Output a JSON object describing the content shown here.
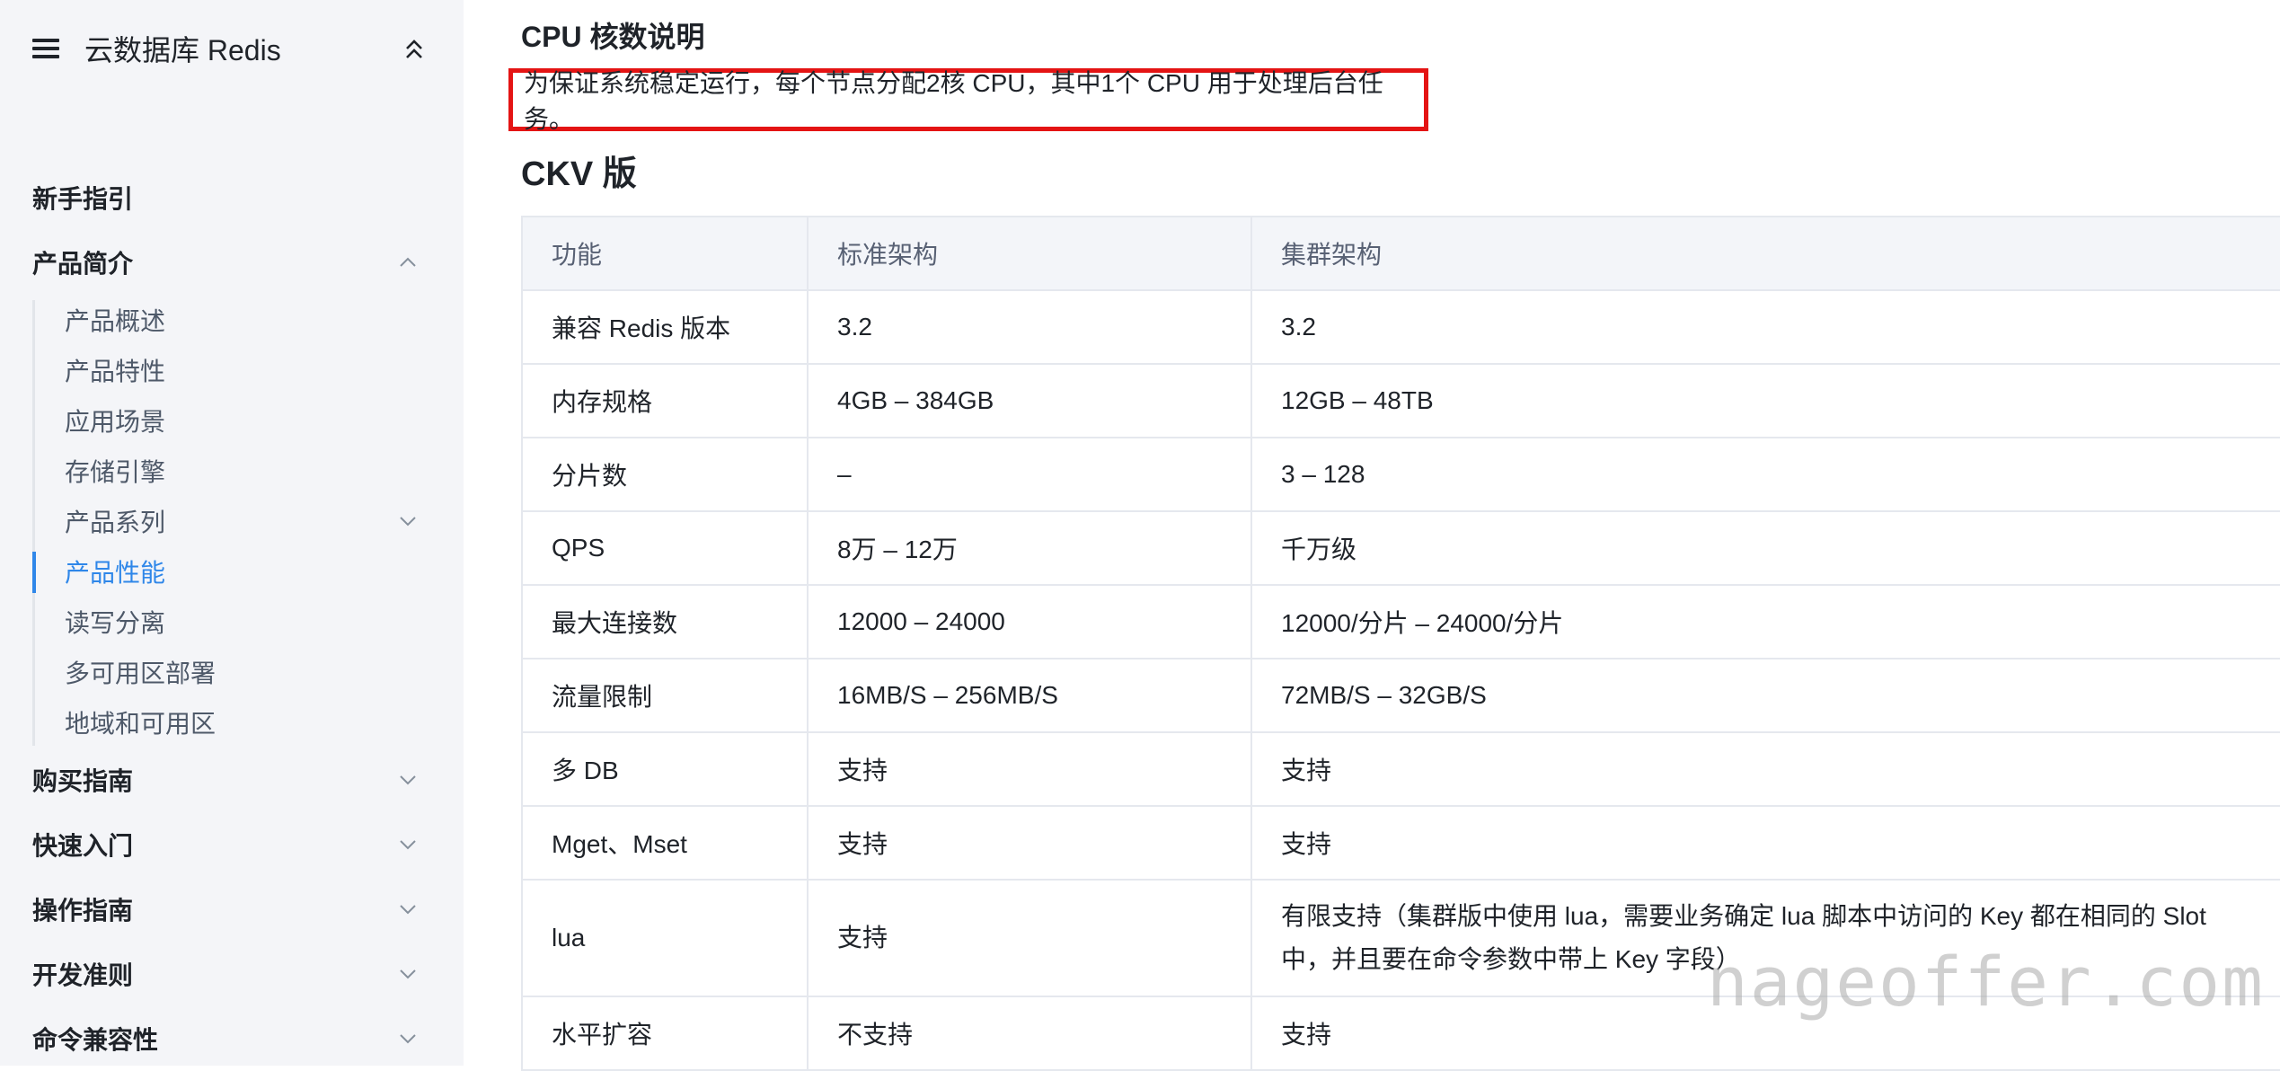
{
  "sidebar": {
    "title": "云数据库 Redis",
    "groups": [
      {
        "label": "新手指引"
      },
      {
        "label": "产品简介"
      },
      {
        "label": "购买指南"
      },
      {
        "label": "快速入门"
      },
      {
        "label": "操作指南"
      },
      {
        "label": "开发准则"
      },
      {
        "label": "命令兼容性"
      }
    ],
    "sub_items": [
      {
        "label": "产品概述"
      },
      {
        "label": "产品特性"
      },
      {
        "label": "应用场景"
      },
      {
        "label": "存储引擎"
      },
      {
        "label": "产品系列"
      },
      {
        "label": "产品性能"
      },
      {
        "label": "读写分离"
      },
      {
        "label": "多可用区部署"
      },
      {
        "label": "地域和可用区"
      }
    ],
    "active_item": "产品性能"
  },
  "main": {
    "cpu_heading": "CPU 核数说明",
    "cpu_note": "为保证系统稳定运行，每个节点分配2核 CPU，其中1个 CPU 用于处理后台任务。",
    "ckv_heading": "CKV 版",
    "table": {
      "headers": [
        "功能",
        "标准架构",
        "集群架构"
      ],
      "rows": [
        [
          "兼容 Redis 版本",
          "3.2",
          "3.2"
        ],
        [
          "内存规格",
          "4GB – 384GB",
          "12GB – 48TB"
        ],
        [
          "分片数",
          "–",
          "3 – 128"
        ],
        [
          "QPS",
          "8万 – 12万",
          "千万级"
        ],
        [
          "最大连接数",
          "12000 – 24000",
          "12000/分片 – 24000/分片"
        ],
        [
          "流量限制",
          "16MB/S – 256MB/S",
          "72MB/S – 32GB/S"
        ],
        [
          "多 DB",
          "支持",
          "支持"
        ],
        [
          "Mget、Mset",
          "支持",
          "支持"
        ],
        [
          "lua",
          "支持",
          "有限支持（集群版中使用 lua，需要业务确定 lua 脚本中访问的 Key 都在相同的 Slot 中，并且要在命令参数中带上 Key 字段）"
        ],
        [
          "水平扩容",
          "不支持",
          "支持"
        ]
      ]
    }
  },
  "watermark": "nageoffer.com",
  "colors": {
    "accent": "#2f87e9",
    "highlight_border": "#e41414",
    "sidebar_bg": "#f4f5f8"
  }
}
